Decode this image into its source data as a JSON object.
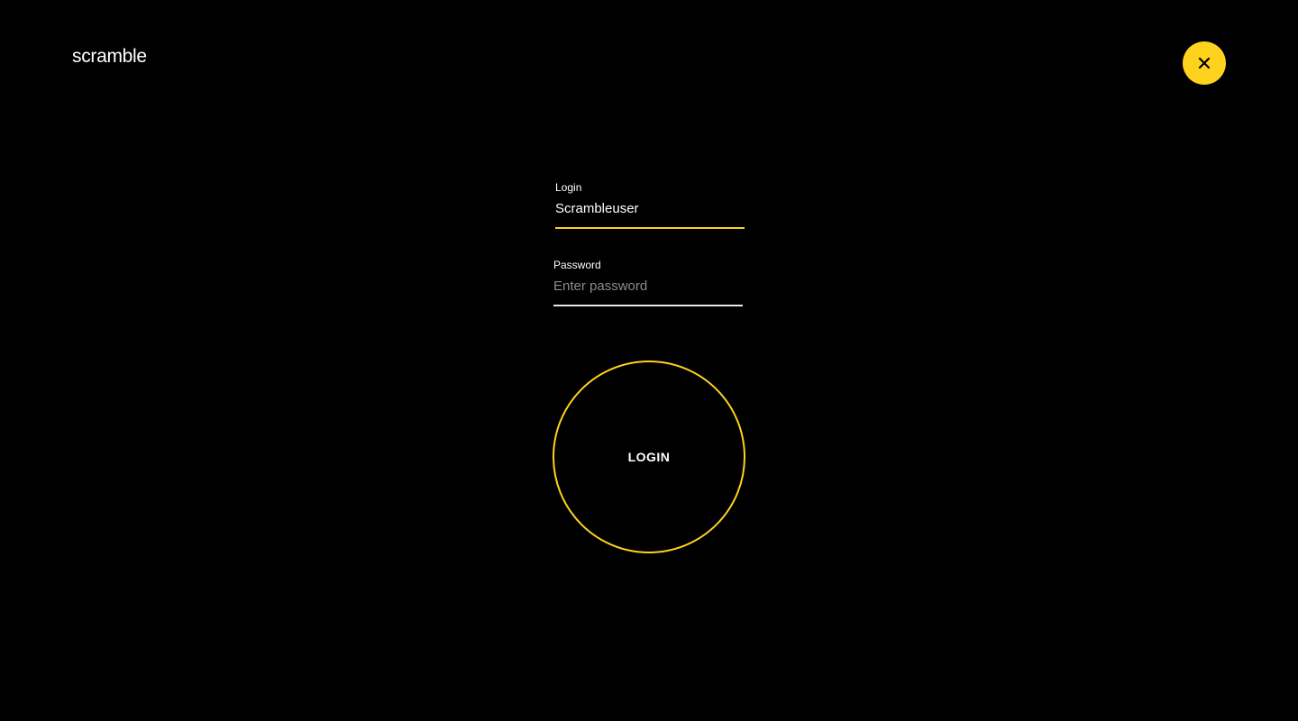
{
  "brand": {
    "logo_text": "scramble",
    "accent_color": "#ffd21e"
  },
  "header": {
    "close_icon": "close-icon"
  },
  "form": {
    "login": {
      "label": "Login",
      "value": "Scrambleuser"
    },
    "password": {
      "label": "Password",
      "value": "",
      "placeholder": "Enter password"
    },
    "submit_label": "LOGIN"
  }
}
